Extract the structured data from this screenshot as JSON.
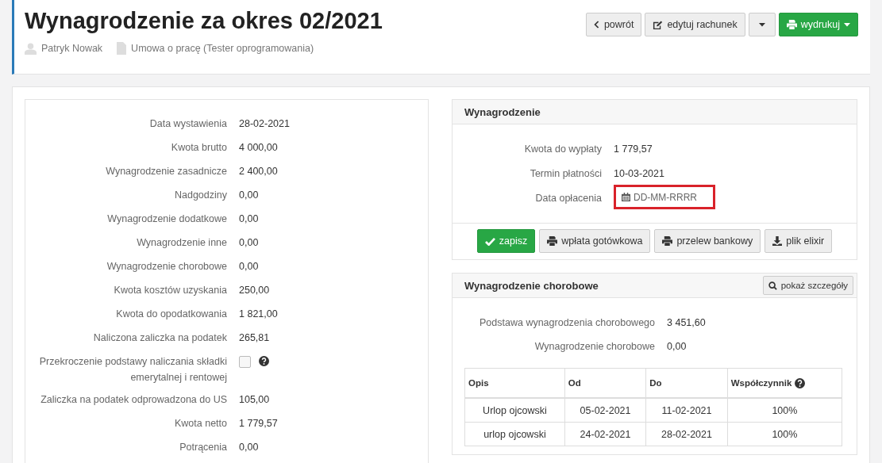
{
  "header": {
    "title": "Wynagrodzenie za okres 02/2021",
    "person": "Patryk Nowak",
    "contract": "Umowa o pracę (Tester oprogramowania)",
    "buttons": [
      {
        "kind": "back",
        "label": "powrót"
      },
      {
        "kind": "edit",
        "label": "edytuj rachunek"
      },
      {
        "kind": "caret"
      },
      {
        "kind": "print",
        "label": "wydrukuj"
      }
    ]
  },
  "details": [
    {
      "kind": "text",
      "label": "Data wystawienia",
      "value": "28-02-2021"
    },
    {
      "kind": "text",
      "label": "Kwota brutto",
      "value": "4 000,00"
    },
    {
      "kind": "text",
      "label": "Wynagrodzenie zasadnicze",
      "value": "2 400,00"
    },
    {
      "kind": "text",
      "label": "Nadgodziny",
      "value": "0,00"
    },
    {
      "kind": "text",
      "label": "Wynagrodzenie dodatkowe",
      "value": "0,00"
    },
    {
      "kind": "text",
      "label": "Wynagrodzenie inne",
      "value": "0,00"
    },
    {
      "kind": "text",
      "label": "Wynagrodzenie chorobowe",
      "value": "0,00"
    },
    {
      "kind": "text",
      "label": "Kwota kosztów uzyskania",
      "value": "250,00"
    },
    {
      "kind": "text",
      "label": "Kwota do opodatkowania",
      "value": "1 821,00"
    },
    {
      "kind": "text",
      "label": "Naliczona zaliczka na podatek",
      "value": "265,81"
    },
    {
      "kind": "checkbox",
      "label": "Przekroczenie podstawy naliczania składki emerytalnej i rentowej",
      "checked": false
    },
    {
      "kind": "text",
      "label": "Zaliczka na podatek odprowadzona do US",
      "value": "105,00"
    },
    {
      "kind": "text",
      "label": "Kwota netto",
      "value": "1 779,57"
    },
    {
      "kind": "text",
      "label": "Potrącenia",
      "value": "0,00"
    }
  ],
  "payment": {
    "title": "Wynagrodzenie",
    "rows": [
      {
        "kind": "text",
        "label": "Kwota do wypłaty",
        "value": "1 779,57"
      },
      {
        "kind": "text",
        "label": "Termin płatności",
        "value": "10-03-2021"
      },
      {
        "kind": "date",
        "label": "Data opłacenia",
        "placeholder": "DD-MM-RRRR"
      }
    ],
    "buttons": [
      {
        "kind": "save",
        "label": "zapisz"
      },
      {
        "kind": "print",
        "label": "wpłata gotówkowa"
      },
      {
        "kind": "print",
        "label": "przelew bankowy"
      },
      {
        "kind": "download",
        "label": "plik elixir"
      }
    ]
  },
  "sick": {
    "title": "Wynagrodzenie chorobowe",
    "details_button": "pokaż szczegóły",
    "rows": [
      {
        "label": "Podstawa wynagrodzenia chorobowego",
        "value": "3 451,60"
      },
      {
        "label": "Wynagrodzenie chorobowe",
        "value": "0,00"
      }
    ],
    "table": {
      "columns": [
        {
          "label": "Opis",
          "help": false
        },
        {
          "label": "Od",
          "help": false
        },
        {
          "label": "Do",
          "help": false
        },
        {
          "label": "Współczynnik",
          "help": true
        }
      ],
      "rows": [
        [
          "Urlop ojcowski",
          "05-02-2021",
          "11-02-2021",
          "100%"
        ],
        [
          "urlop ojcowski",
          "24-02-2021",
          "28-02-2021",
          "100%"
        ]
      ]
    }
  }
}
